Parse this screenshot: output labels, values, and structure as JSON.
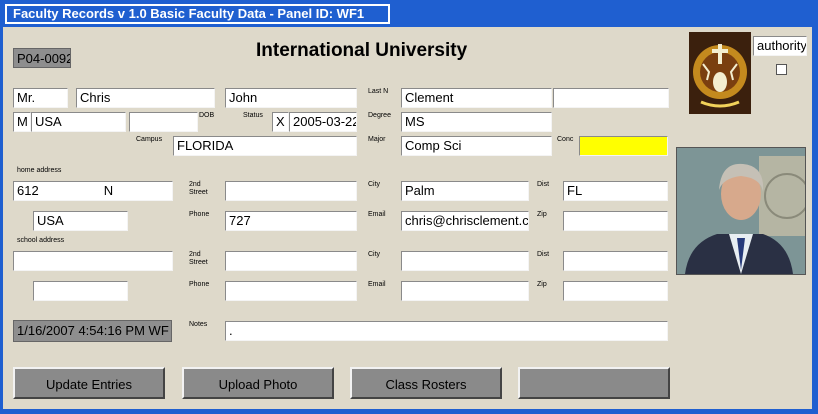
{
  "window": {
    "title": "Faculty Records v 1.0 Basic Faculty Data - Panel ID: WF1"
  },
  "header": {
    "record_id": "P04-0092",
    "heading": "International University",
    "authority_label": "authority"
  },
  "labels": {
    "last_n": "Last N",
    "dob": "DOB",
    "status": "Status",
    "degree": "Degree",
    "campus": "Campus",
    "major": "Major",
    "conc": "Conc",
    "home_address": "home address",
    "second_street": "2nd Street",
    "city": "City",
    "dist": "Dist",
    "phone": "Phone",
    "email": "Email",
    "zip": "Zip",
    "school_address": "school address",
    "notes": "Notes"
  },
  "fields": {
    "prefix": "Mr.",
    "first_name": "Chris",
    "middle_name": "John",
    "last_name": "Clement",
    "suffix": "",
    "gender": "M",
    "citizenship": "USA",
    "dob": "",
    "status": "X",
    "status_date": "2005-03-22",
    "degree": "MS",
    "campus": "FLORIDA",
    "major": "Comp Sci",
    "conc": "",
    "home_street": "612                  N",
    "home_street2": "",
    "home_city": "Palm",
    "home_dist": "FL",
    "home_country": "USA",
    "home_phone": "727",
    "home_email": "chris@chrisclement.c",
    "home_zip": "",
    "school_street": "",
    "school_street2": "",
    "school_city": "",
    "school_dist": "",
    "school_country": "",
    "school_phone": "",
    "school_email": "",
    "school_zip": "",
    "notes": "."
  },
  "timestamp": "1/16/2007 4:54:16 PM WF",
  "buttons": {
    "update": "Update Entries",
    "upload": "Upload Photo",
    "rosters": "Class Rosters",
    "blank": ""
  },
  "colors": {
    "title_bg": "#1f5fd0",
    "panel_bg": "#ded9ca",
    "conc_highlight": "#ffff00"
  }
}
